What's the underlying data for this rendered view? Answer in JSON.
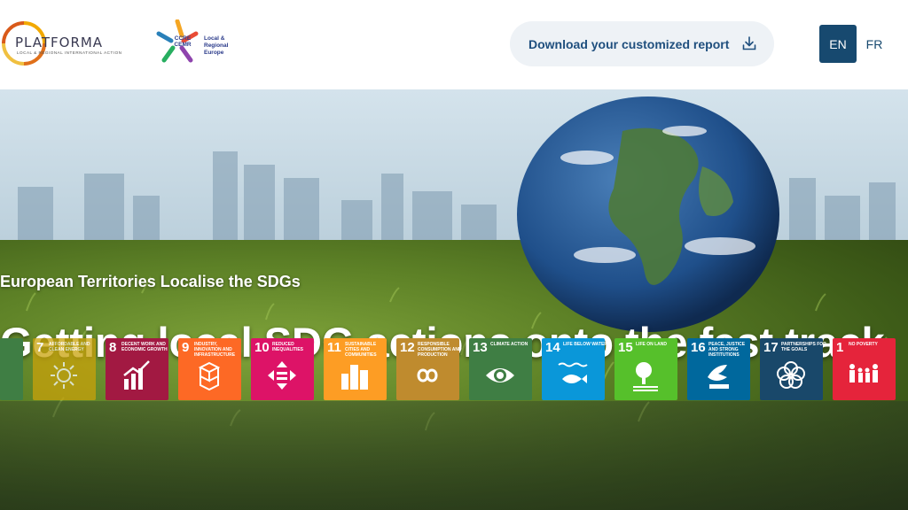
{
  "header": {
    "platforma_name": "PLATFORMA",
    "platforma_subtitle": "LOCAL & REGIONAL INTERNATIONAL ACTION",
    "ccre_mark": "CCRE CEMR",
    "ccre_text_1": "Local &",
    "ccre_text_2": "Regional",
    "ccre_text_3": "Europe",
    "download_label": "Download your customized report",
    "lang_en": "EN",
    "lang_fr": "FR"
  },
  "hero": {
    "eyebrow": "European Territories Localise the SDGs",
    "headline": "Getting local SDG actions onto the fast track"
  },
  "colors": {
    "brand_blue": "#17496f",
    "button_bg": "#eef2f6"
  },
  "sdg_tiles": [
    {
      "num": "",
      "label": "",
      "color": "#3f7e44",
      "icon": "partial-tile"
    },
    {
      "num": "7",
      "label": "AFFORDABLE AND CLEAN ENERGY",
      "color": "#c9a20a",
      "icon": "sun-icon"
    },
    {
      "num": "8",
      "label": "DECENT WORK AND ECONOMIC GROWTH",
      "color": "#a21942",
      "icon": "growth-chart-icon"
    },
    {
      "num": "9",
      "label": "INDUSTRY, INNOVATION AND INFRASTRUCTURE",
      "color": "#fd6925",
      "icon": "cubes-icon"
    },
    {
      "num": "10",
      "label": "REDUCED INEQUALITIES",
      "color": "#dd1367",
      "icon": "arrows-icon"
    },
    {
      "num": "11",
      "label": "SUSTAINABLE CITIES AND COMMUNITIES",
      "color": "#fd9d24",
      "icon": "buildings-icon"
    },
    {
      "num": "12",
      "label": "RESPONSIBLE CONSUMPTION AND PRODUCTION",
      "color": "#bf8b2e",
      "icon": "infinity-icon"
    },
    {
      "num": "13",
      "label": "CLIMATE ACTION",
      "color": "#3f7e44",
      "icon": "eye-globe-icon"
    },
    {
      "num": "14",
      "label": "LIFE BELOW WATER",
      "color": "#0a97d9",
      "icon": "fish-icon"
    },
    {
      "num": "15",
      "label": "LIFE ON LAND",
      "color": "#56c02b",
      "icon": "tree-icon"
    },
    {
      "num": "16",
      "label": "PEACE, JUSTICE AND STRONG INSTITUTIONS",
      "color": "#00689d",
      "icon": "dove-icon"
    },
    {
      "num": "17",
      "label": "PARTNERSHIPS FOR THE GOALS",
      "color": "#19486a",
      "icon": "rings-icon"
    },
    {
      "num": "1",
      "label": "NO POVERTY",
      "color": "#e5243b",
      "icon": "family-icon"
    }
  ]
}
